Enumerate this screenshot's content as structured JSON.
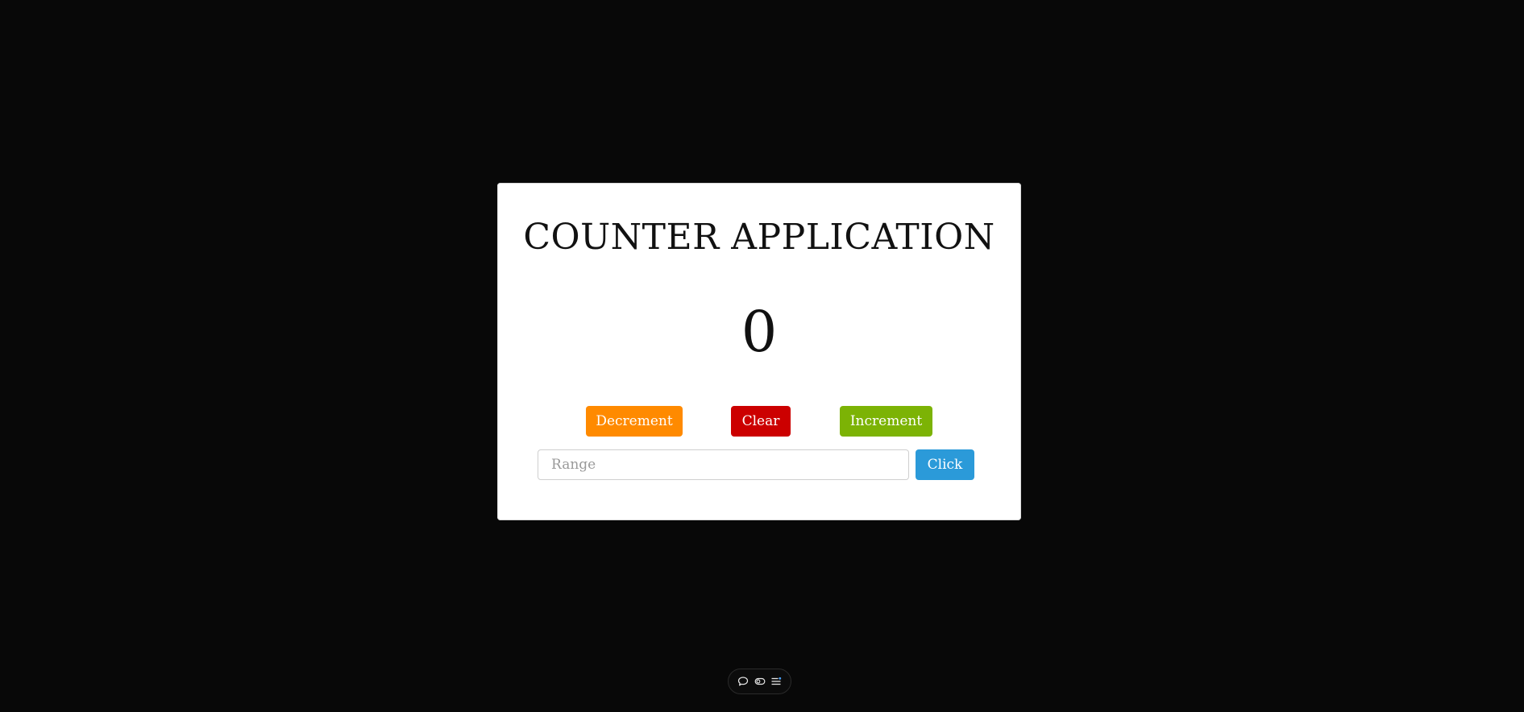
{
  "counter": {
    "title": "COUNTER APPLICATION",
    "value": "0"
  },
  "controls": {
    "decrement_label": "Decrement",
    "clear_label": "Clear",
    "increment_label": "Increment"
  },
  "range": {
    "placeholder": "Range",
    "value": "",
    "submit_label": "Click"
  },
  "colors": {
    "background": "#080808",
    "card": "#ffffff",
    "decrement": "#ff8a00",
    "clear": "#cc0000",
    "increment": "#7cb305",
    "click": "#2b9ad9"
  },
  "dock": {
    "icons": [
      "chat-bubble-icon",
      "toggle-icon",
      "menu-list-icon"
    ]
  }
}
